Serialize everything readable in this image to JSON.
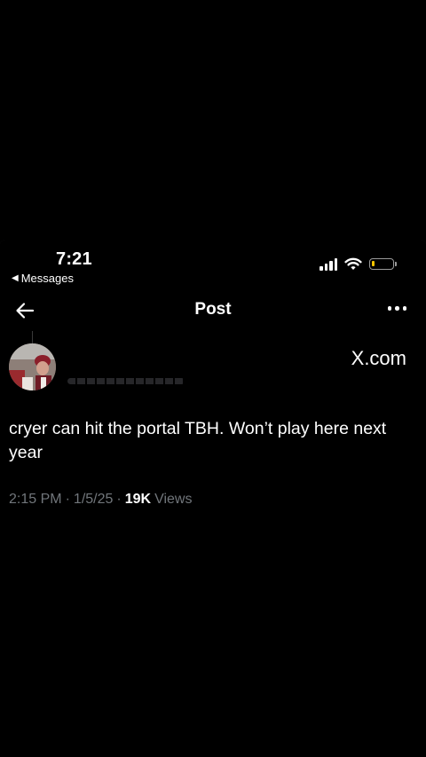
{
  "status_bar": {
    "time": "7:21",
    "back_label": "Messages"
  },
  "nav": {
    "title": "Post"
  },
  "post": {
    "source": "X.com",
    "text": "cryer can hit the portal TBH. Won’t play here next year",
    "time": "2:15 PM",
    "separator": "·",
    "date": "1/5/25",
    "views_count": "19K",
    "views_label": "Views"
  },
  "colors": {
    "background": "#000000",
    "text": "#ffffff",
    "secondary_text": "#71767b",
    "battery_fill": "#f5c400"
  }
}
